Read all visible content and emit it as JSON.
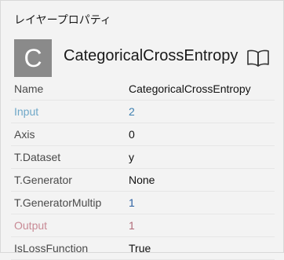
{
  "panel": {
    "title": "レイヤープロパティ"
  },
  "layer": {
    "icon_letter": "C",
    "name": "CategoricalCrossEntropy",
    "doc_icon": "open-book-icon"
  },
  "properties": [
    {
      "label": "Name",
      "value": "CategoricalCrossEntropy"
    },
    {
      "label": "Input",
      "value": "2"
    },
    {
      "label": "Axis",
      "value": "0"
    },
    {
      "label": "T.Dataset",
      "value": "y"
    },
    {
      "label": "T.Generator",
      "value": "None"
    },
    {
      "label": "T.GeneratorMultip",
      "value": "1"
    },
    {
      "label": "Output",
      "value": "1"
    },
    {
      "label": "IsLossFunction",
      "value": "True"
    }
  ],
  "colors": {
    "input_label": "#6fa8c8",
    "output_label": "#c88a95",
    "avatar_bg": "#8a8a8a"
  }
}
